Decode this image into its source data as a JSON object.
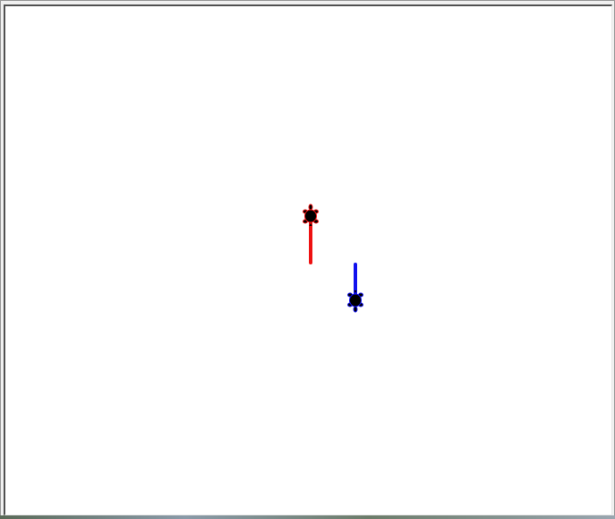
{
  "colors": {
    "canvas_background": "#ffffff",
    "turtle_one_pen": "#ee1111",
    "turtle_two_pen": "#1111ee",
    "turtle_body": "#000000"
  },
  "turtles": [
    {
      "name": "red-turtle",
      "pen_color": "#ee1111",
      "heading": "up"
    },
    {
      "name": "blue-turtle",
      "pen_color": "#1111ee",
      "heading": "down"
    }
  ]
}
